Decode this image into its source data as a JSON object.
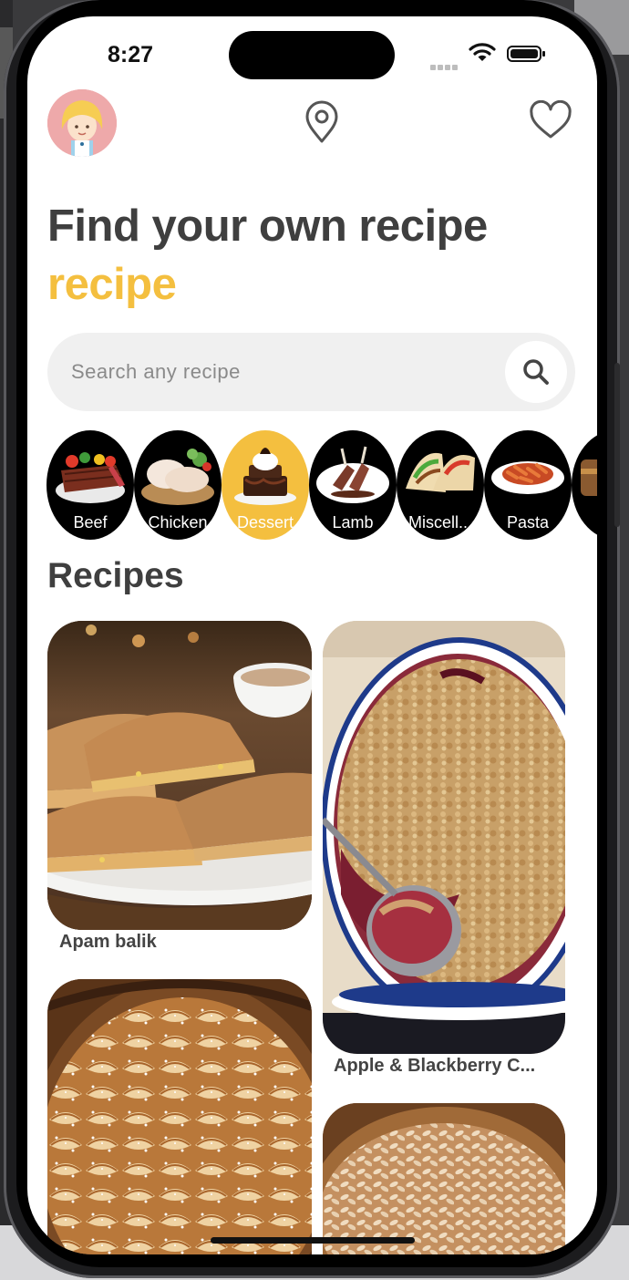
{
  "status_bar": {
    "time": "8:27"
  },
  "header": {
    "avatar": "avatar",
    "location_icon": "location-pin-icon",
    "favorite_icon": "heart-icon"
  },
  "hero": {
    "title": "Find your own recipe",
    "highlight": "recipe"
  },
  "search": {
    "placeholder": "Search any recipe",
    "icon": "search-icon"
  },
  "categories": [
    {
      "label": "Beef",
      "selected": false
    },
    {
      "label": "Chicken",
      "selected": false
    },
    {
      "label": "Dessert",
      "selected": true
    },
    {
      "label": "Lamb",
      "selected": false
    },
    {
      "label": "Miscell...",
      "selected": false
    },
    {
      "label": "Pasta",
      "selected": false
    },
    {
      "label": "",
      "selected": false
    }
  ],
  "section": {
    "title": "Recipes"
  },
  "recipes": [
    {
      "name": "Apam balik"
    },
    {
      "name": "Apple & Blackberry C..."
    },
    {
      "name": ""
    },
    {
      "name": ""
    }
  ],
  "colors": {
    "accent": "#f4bf3f",
    "text": "#3f3f3f",
    "search_bg": "#f0f0f0"
  }
}
